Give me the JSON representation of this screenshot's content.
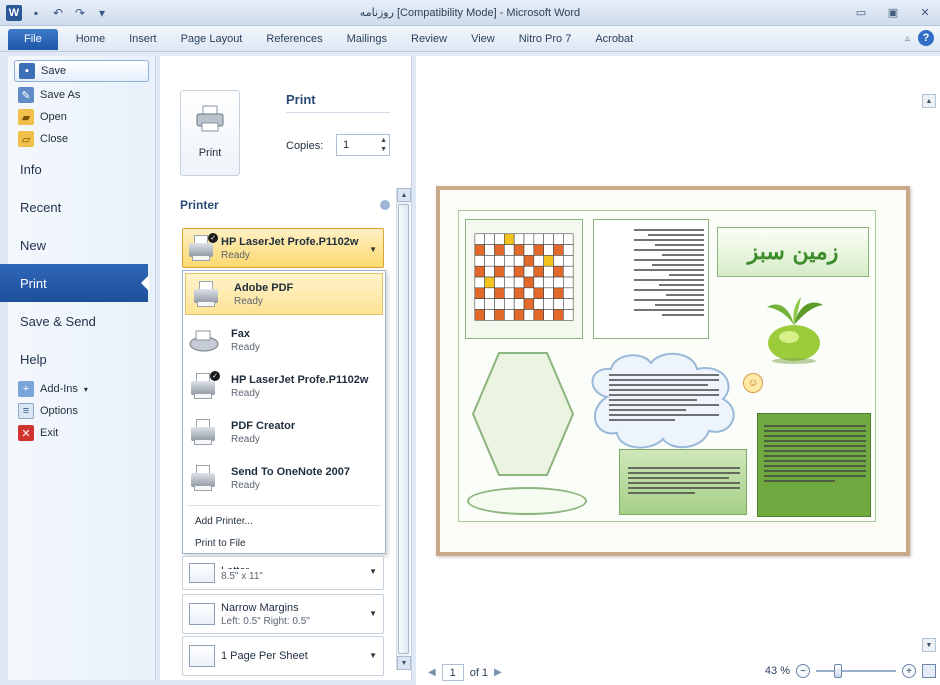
{
  "window": {
    "title": "روزنامه [Compatibility Mode] - Microsoft Word",
    "quick_access": [
      "word-logo",
      "save-icon",
      "undo-icon",
      "redo-icon",
      "customize-icon"
    ]
  },
  "ribbon": {
    "tabs": [
      "File",
      "Home",
      "Insert",
      "Page Layout",
      "References",
      "Mailings",
      "Review",
      "View",
      "Nitro Pro 7",
      "Acrobat"
    ]
  },
  "backstage": {
    "small_items": [
      {
        "label": "Save",
        "icon": "save-icon"
      },
      {
        "label": "Save As",
        "icon": "save-as-icon"
      },
      {
        "label": "Open",
        "icon": "open-folder-icon"
      },
      {
        "label": "Close",
        "icon": "close-folder-icon"
      }
    ],
    "big_items": [
      "Info",
      "Recent",
      "New",
      "Print",
      "Save & Send",
      "Help"
    ],
    "selected": "Print",
    "footer_items": [
      {
        "label": "Add-Ins",
        "icon": "add-ins-icon"
      },
      {
        "label": "Options",
        "icon": "options-icon"
      },
      {
        "label": "Exit",
        "icon": "exit-icon"
      }
    ]
  },
  "print": {
    "heading": "Print",
    "button_label": "Print",
    "copies_label": "Copies:",
    "copies_value": "1",
    "printer_heading": "Printer",
    "selected_printer": {
      "name": "HP LaserJet Profe.P1102w",
      "status": "Ready"
    },
    "printer_list": [
      {
        "name": "Adobe PDF",
        "status": "Ready",
        "highlighted": true
      },
      {
        "name": "Fax",
        "status": "Ready",
        "highlighted": false
      },
      {
        "name": "HP LaserJet Profe.P1102w",
        "status": "Ready",
        "highlighted": false
      },
      {
        "name": "PDF Creator",
        "status": "Ready",
        "highlighted": false
      },
      {
        "name": "Send To OneNote 2007",
        "status": "Ready",
        "highlighted": false
      }
    ],
    "add_printer": "Add Printer...",
    "print_to_file": "Print to File",
    "paper": {
      "name": "Letter",
      "detail": "8.5\" x 11\""
    },
    "margins": {
      "name": "Narrow Margins",
      "detail": "Left: 0.5\"   Right: 0.5\""
    },
    "pages_per_sheet": {
      "name": "1 Page Per Sheet"
    }
  },
  "preview": {
    "page_number": "1",
    "page_of": "of 1",
    "zoom": "43 %",
    "doc_title": "زمین سبز"
  },
  "colors": {
    "accent_blue": "#1e56a8",
    "selection_yellow": "#fcd86e",
    "doc_green": "#6fa93f"
  }
}
